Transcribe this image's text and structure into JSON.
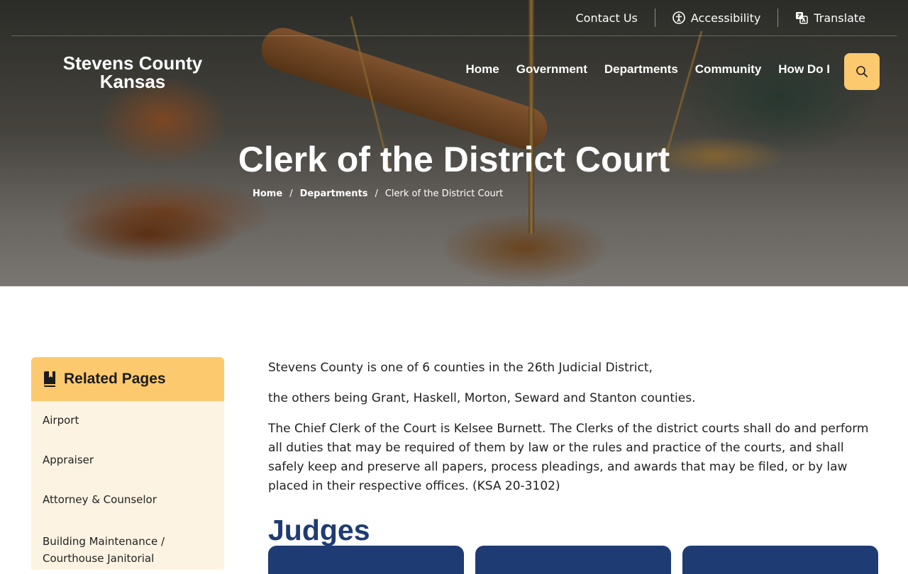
{
  "utility": {
    "contact": "Contact Us",
    "accessibility": "Accessibility",
    "translate": "Translate"
  },
  "logo": {
    "line1": "Stevens County",
    "line2": "Kansas"
  },
  "nav": {
    "items": [
      "Home",
      "Government",
      "Departments",
      "Community",
      "How Do I"
    ]
  },
  "hero": {
    "title": "Clerk of the District Court"
  },
  "breadcrumb": {
    "home": "Home",
    "section": "Departments",
    "current": "Clerk of the District Court",
    "separator": "/"
  },
  "sidebar": {
    "title": "Related Pages",
    "items": [
      "Airport",
      "Appraiser",
      "Attorney & Counselor",
      "Building Maintenance / Courthouse Janitorial"
    ]
  },
  "main": {
    "paragraphs": [
      "Stevens County is one of 6 counties in the 26th Judicial District,",
      "the others being Grant, Haskell, Morton, Seward and Stanton counties.",
      "The Chief Clerk of the Court is Kelsee Burnett. The Clerks of the district courts shall do and perform all duties that may be required of them by law or the rules and practice of the courts, and shall safely keep and preserve all papers, process pleadings, and awards that may be filed, or by law placed in their respective offices. (KSA 20-3102)"
    ],
    "judges_heading": "Judges"
  },
  "colors": {
    "accent": "#fdc96e",
    "sidebar_bg": "#fdf3e2",
    "heading": "#1f3b73"
  },
  "icons": {
    "accessibility": "accessibility-icon",
    "translate": "translate-icon",
    "search": "search-icon",
    "related": "book-bookmark-icon"
  }
}
